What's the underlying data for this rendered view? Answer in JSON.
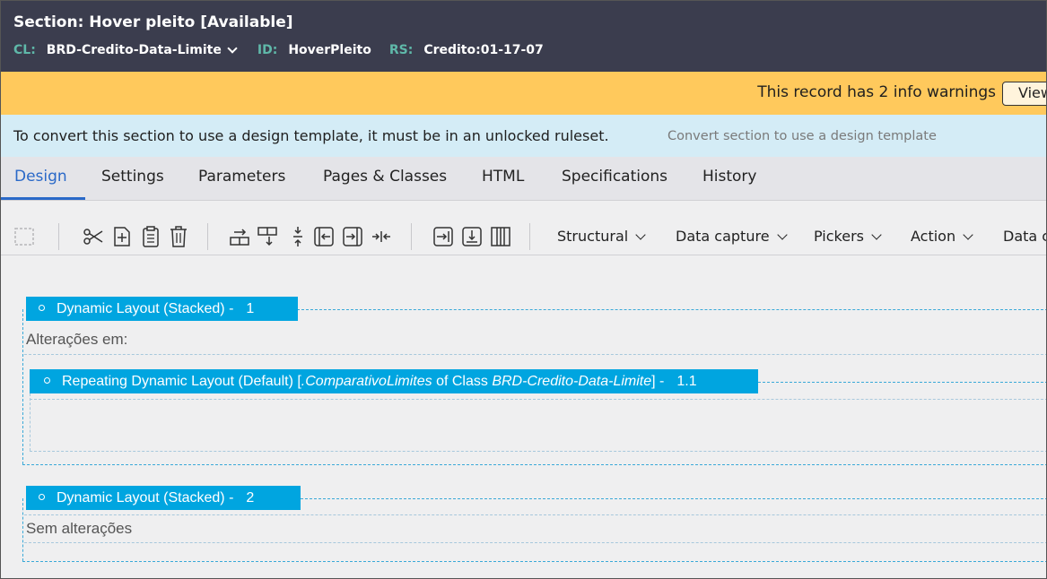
{
  "header": {
    "title": "Section: Hover pleito",
    "status": "[Available]",
    "cl_label": "CL:",
    "cl_value": "BRD-Credito-Data-Limite",
    "id_label": "ID:",
    "id_value": "HoverPleito",
    "rs_label": "RS:",
    "rs_value": "Credito:01-17-07"
  },
  "warning": {
    "message": "This record has 2 info warnings",
    "button": "View"
  },
  "info": {
    "message": "To convert this section to use a design template, it must be in an unlocked ruleset.",
    "link": "Convert section to use a design template"
  },
  "tabs": [
    "Design",
    "Settings",
    "Parameters",
    "Pages & Classes",
    "HTML",
    "Specifications",
    "History"
  ],
  "toolbar": {
    "menus": [
      "Structural",
      "Data capture",
      "Pickers",
      "Action",
      "Data c"
    ],
    "icons": [
      "select-icon",
      "cut-icon",
      "add-icon",
      "paste-icon",
      "delete-icon",
      "insert-row-icon",
      "insert-column-icon",
      "split-icon",
      "move-left-icon",
      "move-right-icon",
      "collapse-icon",
      "indent-right-icon",
      "indent-down-icon",
      "columns-icon"
    ]
  },
  "canvas": {
    "layout1": {
      "label": "Dynamic Layout (Stacked) -",
      "num": "1",
      "field": "Alterações em:"
    },
    "repeat": {
      "prefix": "Repeating Dynamic Layout (Default) [",
      "property": ".ComparativoLimites",
      "mid": " of Class ",
      "class": "BRD-Credito-Data-Limite",
      "suffix": "] -",
      "num": "1.1"
    },
    "layout2": {
      "label": "Dynamic Layout (Stacked) -",
      "num": "2",
      "field": "Sem alterações"
    }
  }
}
